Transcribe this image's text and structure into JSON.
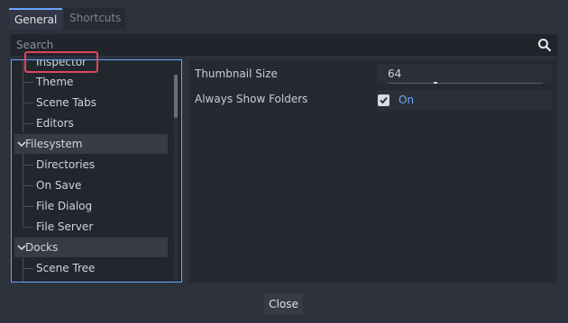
{
  "tabs": [
    {
      "label": "General"
    },
    {
      "label": "Shortcuts"
    }
  ],
  "search": {
    "placeholder": "Search"
  },
  "tree": {
    "items": [
      {
        "label": "Inspector"
      },
      {
        "label": "Theme"
      },
      {
        "label": "Scene Tabs"
      },
      {
        "label": "Editors"
      },
      {
        "label": "Filesystem"
      },
      {
        "label": "Directories"
      },
      {
        "label": "On Save"
      },
      {
        "label": "File Dialog"
      },
      {
        "label": "File Server"
      },
      {
        "label": "Docks"
      },
      {
        "label": "Scene Tree"
      }
    ]
  },
  "properties": {
    "thumbnail_size": {
      "label": "Thumbnail Size",
      "value": "64"
    },
    "always_show_folders": {
      "label": "Always Show Folders",
      "value": "On"
    }
  },
  "footer": {
    "close_label": "Close"
  },
  "icons": {
    "search": "search-icon",
    "chevron": "chevron-down-icon",
    "check": "check-icon"
  },
  "colors": {
    "accent": "#6aa7ff",
    "highlight": "#e0465a"
  }
}
